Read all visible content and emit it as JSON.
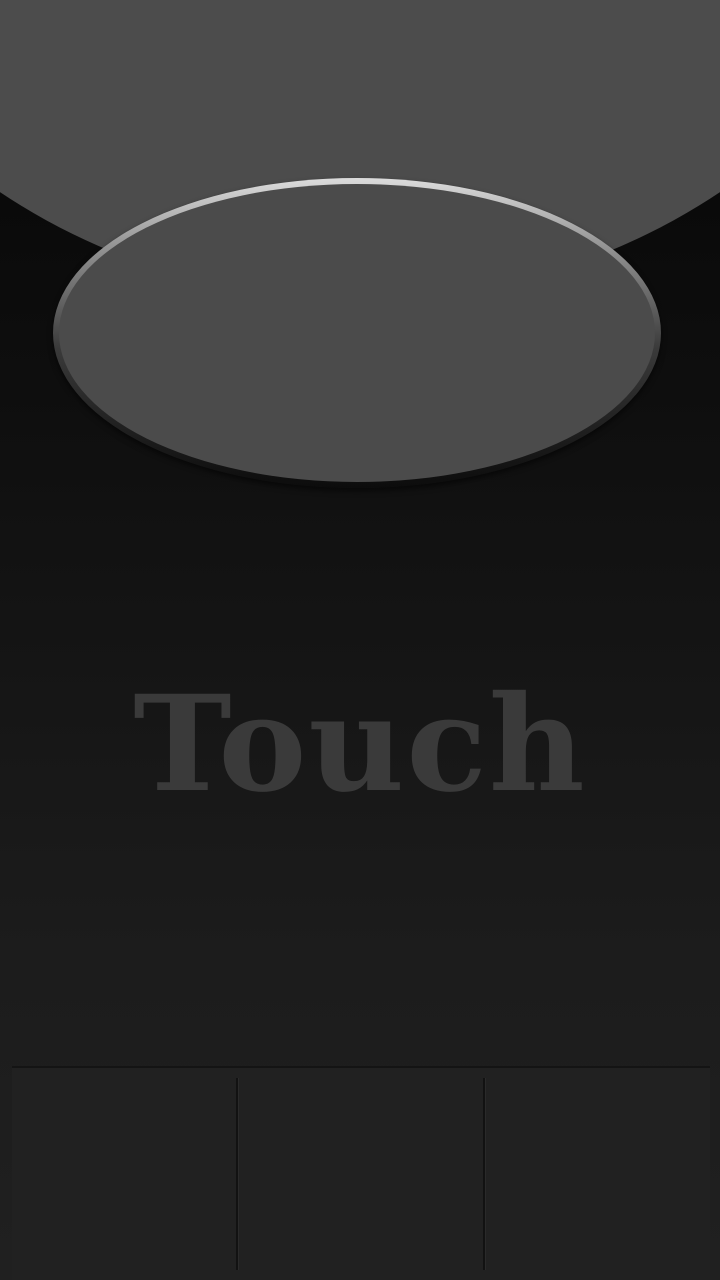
{
  "main": {
    "touch_label": "Touch"
  },
  "colors": {
    "arc": "#4c4c4c",
    "button_face": "#4b4b4b",
    "label": "#3a3a3a",
    "bottom_bar": "#212121"
  }
}
